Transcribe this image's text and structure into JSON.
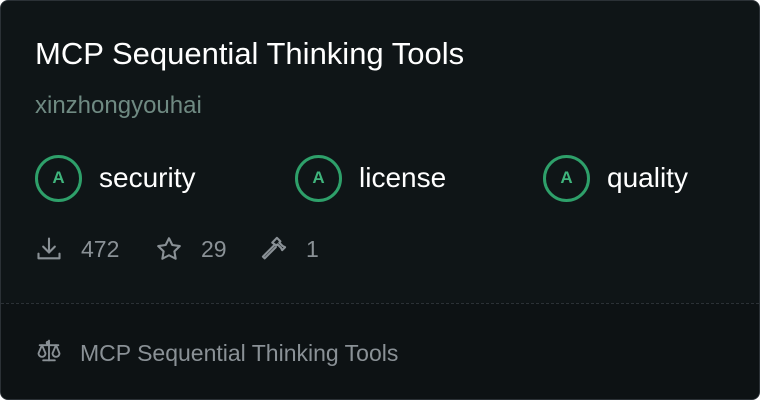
{
  "card": {
    "title": "MCP Sequential Thinking Tools",
    "author": "xinzhongyouhai"
  },
  "badges": [
    {
      "grade": "A",
      "label": "security"
    },
    {
      "grade": "A",
      "label": "license"
    },
    {
      "grade": "A",
      "label": "quality"
    }
  ],
  "stats": {
    "downloads": "472",
    "stars": "29",
    "tools": "1",
    "icons": {
      "downloads": "download-icon",
      "stars": "star-icon",
      "tools": "hammer-icon"
    }
  },
  "footer": {
    "icon": "scale-icon",
    "text": "MCP Sequential Thinking Tools"
  },
  "colors": {
    "background": "#0f1517",
    "grade_accent": "#2ea06a",
    "author": "#6f8a82",
    "muted": "#8a9196"
  }
}
